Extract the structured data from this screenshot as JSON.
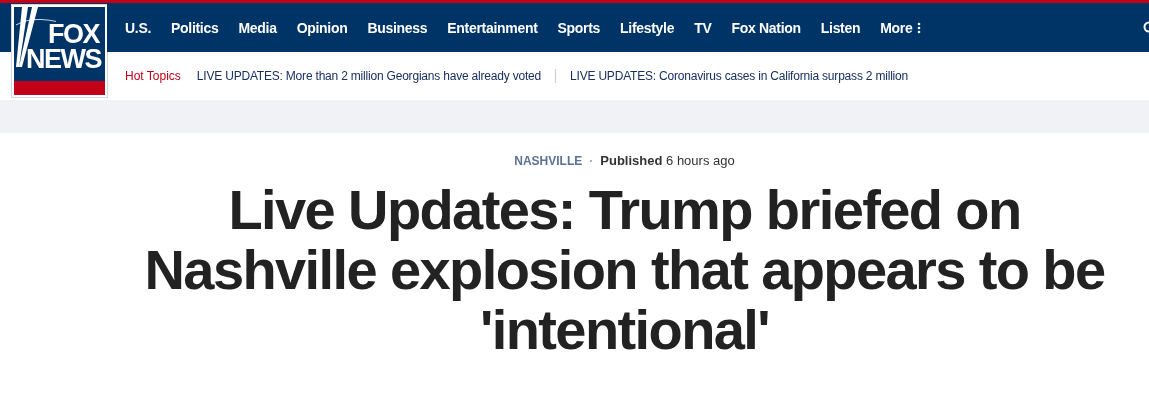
{
  "logo": {
    "line_1": "FOX",
    "line_2": "NEWS"
  },
  "nav": {
    "items": [
      "U.S.",
      "Politics",
      "Media",
      "Opinion",
      "Business",
      "Entertainment",
      "Sports",
      "Lifestyle",
      "TV",
      "Fox Nation",
      "Listen"
    ],
    "more": "More"
  },
  "hot_topics": {
    "label": "Hot Topics",
    "items": [
      "LIVE UPDATES: More than 2 million Georgians have already voted",
      "LIVE UPDATES: Coronavirus cases in California surpass 2 million"
    ]
  },
  "article": {
    "category": "NASHVILLE",
    "published_label": "Published",
    "published_time": "6 hours ago",
    "headline": "Live Updates: Trump briefed on Nashville explosion that appears to be 'intentional'"
  }
}
